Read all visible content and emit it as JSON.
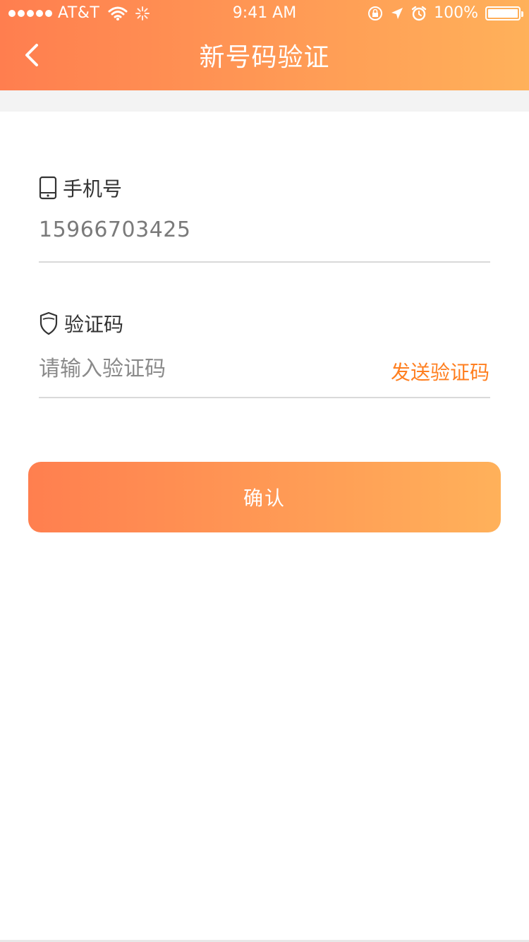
{
  "status_bar": {
    "carrier": "AT&T",
    "time": "9:41 AM",
    "battery": "100%"
  },
  "header": {
    "title": "新号码验证",
    "back_icon": "chevron-left-icon"
  },
  "form": {
    "phone_label": "手机号",
    "phone_value": "15966703425",
    "code_label": "验证码",
    "code_placeholder": "请输入验证码",
    "code_value": "",
    "send_code_label": "发送验证码"
  },
  "confirm_label": "确认",
  "colors": {
    "accent_start": "#ff7e4f",
    "accent_end": "#ffb15a",
    "link_orange": "#ff7f20"
  }
}
